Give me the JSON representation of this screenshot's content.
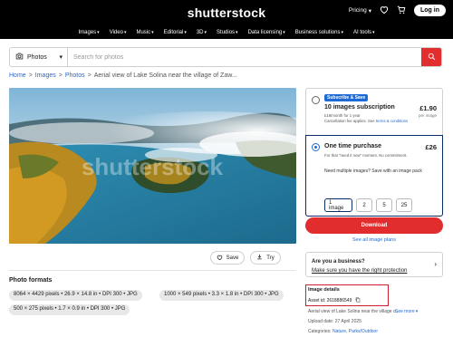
{
  "header": {
    "logo": "shutterstock",
    "pricing_label": "Pricing",
    "login_label": "Log in",
    "nav": [
      "Images",
      "Video",
      "Music",
      "Editorial",
      "3D",
      "Studios",
      "Data licensing",
      "Business solutions",
      "AI tools"
    ]
  },
  "search": {
    "type_label": "Photos",
    "placeholder": "Search for photos"
  },
  "breadcrumb": {
    "items": [
      "Home",
      "Images",
      "Photos"
    ],
    "current": "Aerial view of Lake Solina near the village of Zaw..."
  },
  "image": {
    "watermark": "shutterstock",
    "save_label": "Save",
    "try_label": "Try"
  },
  "formats": {
    "title": "Photo formats",
    "chips": [
      "8064 × 4429 pixels • 26.9 × 14.8 in • DPI 300 • JPG",
      "1000 × 549 pixels • 3.3 × 1.8 in • DPI 300 • JPG",
      "500 × 275 pixels • 1.7 × 0.9 in • DPI 300 • JPG"
    ]
  },
  "plans": {
    "subscription": {
      "badge": "Subscribe & Save",
      "title": "10 images subscription",
      "desc_line1": "£19/month for 1 year",
      "desc_line2": "Cancellation fee applies. See ",
      "desc_link": "terms & conditions",
      "price": "£1.90",
      "price_note": "per image"
    },
    "one_time": {
      "title": "One time purchase",
      "desc": "For that \"need it now\" moment. No commitment.",
      "prompt": "Need multiple images? Save with an image pack",
      "price": "£26",
      "packs": [
        "1 image",
        "2",
        "5",
        "25"
      ]
    },
    "download_label": "Download",
    "see_all_label": "See all image plans"
  },
  "business": {
    "title": "Are you a business?",
    "link": "Make sure you have the right protection"
  },
  "details": {
    "title": "Image details",
    "asset_id": "Asset id: 2618886549",
    "description": "Aerial view of Lake Solina near the village o...",
    "see_more": "See more",
    "upload_date": "Upload date: 27 April 2025",
    "categories_label": "Categories: ",
    "categories_link": "Nature, Parks/Outdoor"
  },
  "colors": {
    "accent_red": "#e12d2d",
    "link_blue": "#1e6ad6",
    "selected_navy": "#0a2d6b",
    "highlight_box": "#d21e2e"
  }
}
